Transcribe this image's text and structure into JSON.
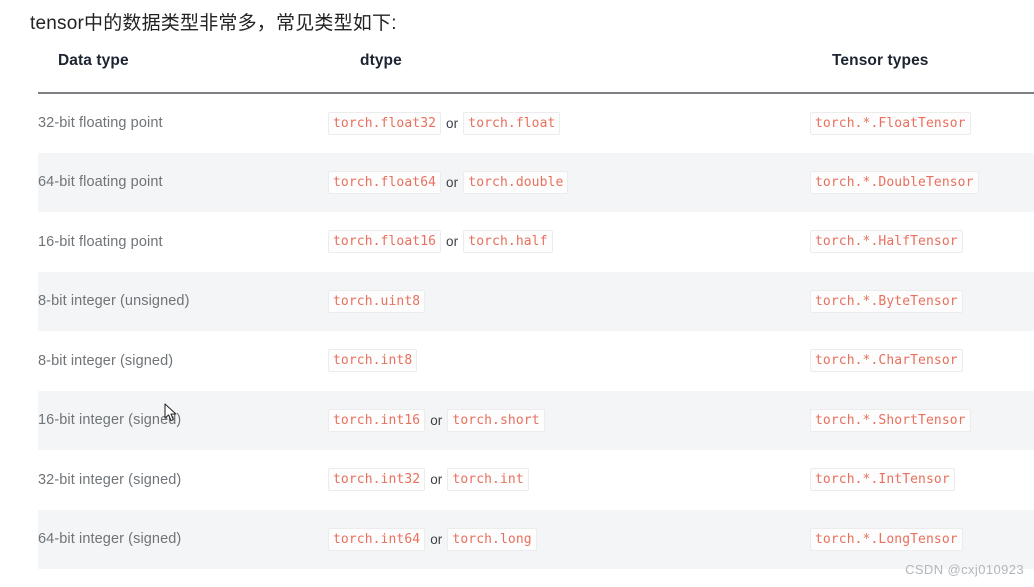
{
  "intro": {
    "text": "tensor中的数据类型非常多，常见类型如下:"
  },
  "table": {
    "headers": {
      "data_type": "Data type",
      "dtype": "dtype",
      "tensor_types": "Tensor types"
    },
    "or_label": "or",
    "rows": [
      {
        "data_type": "32-bit floating point",
        "dtype_primary": "torch.float32",
        "dtype_alt": "torch.float",
        "tensor_type": "torch.*.FloatTensor"
      },
      {
        "data_type": "64-bit floating point",
        "dtype_primary": "torch.float64",
        "dtype_alt": "torch.double",
        "tensor_type": "torch.*.DoubleTensor"
      },
      {
        "data_type": "16-bit floating point",
        "dtype_primary": "torch.float16",
        "dtype_alt": "torch.half",
        "tensor_type": "torch.*.HalfTensor"
      },
      {
        "data_type": "8-bit integer (unsigned)",
        "dtype_primary": "torch.uint8",
        "dtype_alt": "",
        "tensor_type": "torch.*.ByteTensor"
      },
      {
        "data_type": "8-bit integer (signed)",
        "dtype_primary": "torch.int8",
        "dtype_alt": "",
        "tensor_type": "torch.*.CharTensor"
      },
      {
        "data_type": "16-bit integer (signed)",
        "dtype_primary": "torch.int16",
        "dtype_alt": "torch.short",
        "tensor_type": "torch.*.ShortTensor"
      },
      {
        "data_type": "32-bit integer (signed)",
        "dtype_primary": "torch.int32",
        "dtype_alt": "torch.int",
        "tensor_type": "torch.*.IntTensor"
      },
      {
        "data_type": "64-bit integer (signed)",
        "dtype_primary": "torch.int64",
        "dtype_alt": "torch.long",
        "tensor_type": "torch.*.LongTensor"
      }
    ]
  },
  "watermark": {
    "text": "CSDN @cxj010923"
  },
  "colors": {
    "code_text": "#e8705d",
    "code_border": "#ececec",
    "row_alt_bg": "#f4f5f6",
    "header_rule": "#7d8085",
    "body_text": "#6f7478",
    "header_text": "#1b2430",
    "watermark_text": "#b3b7bb"
  }
}
